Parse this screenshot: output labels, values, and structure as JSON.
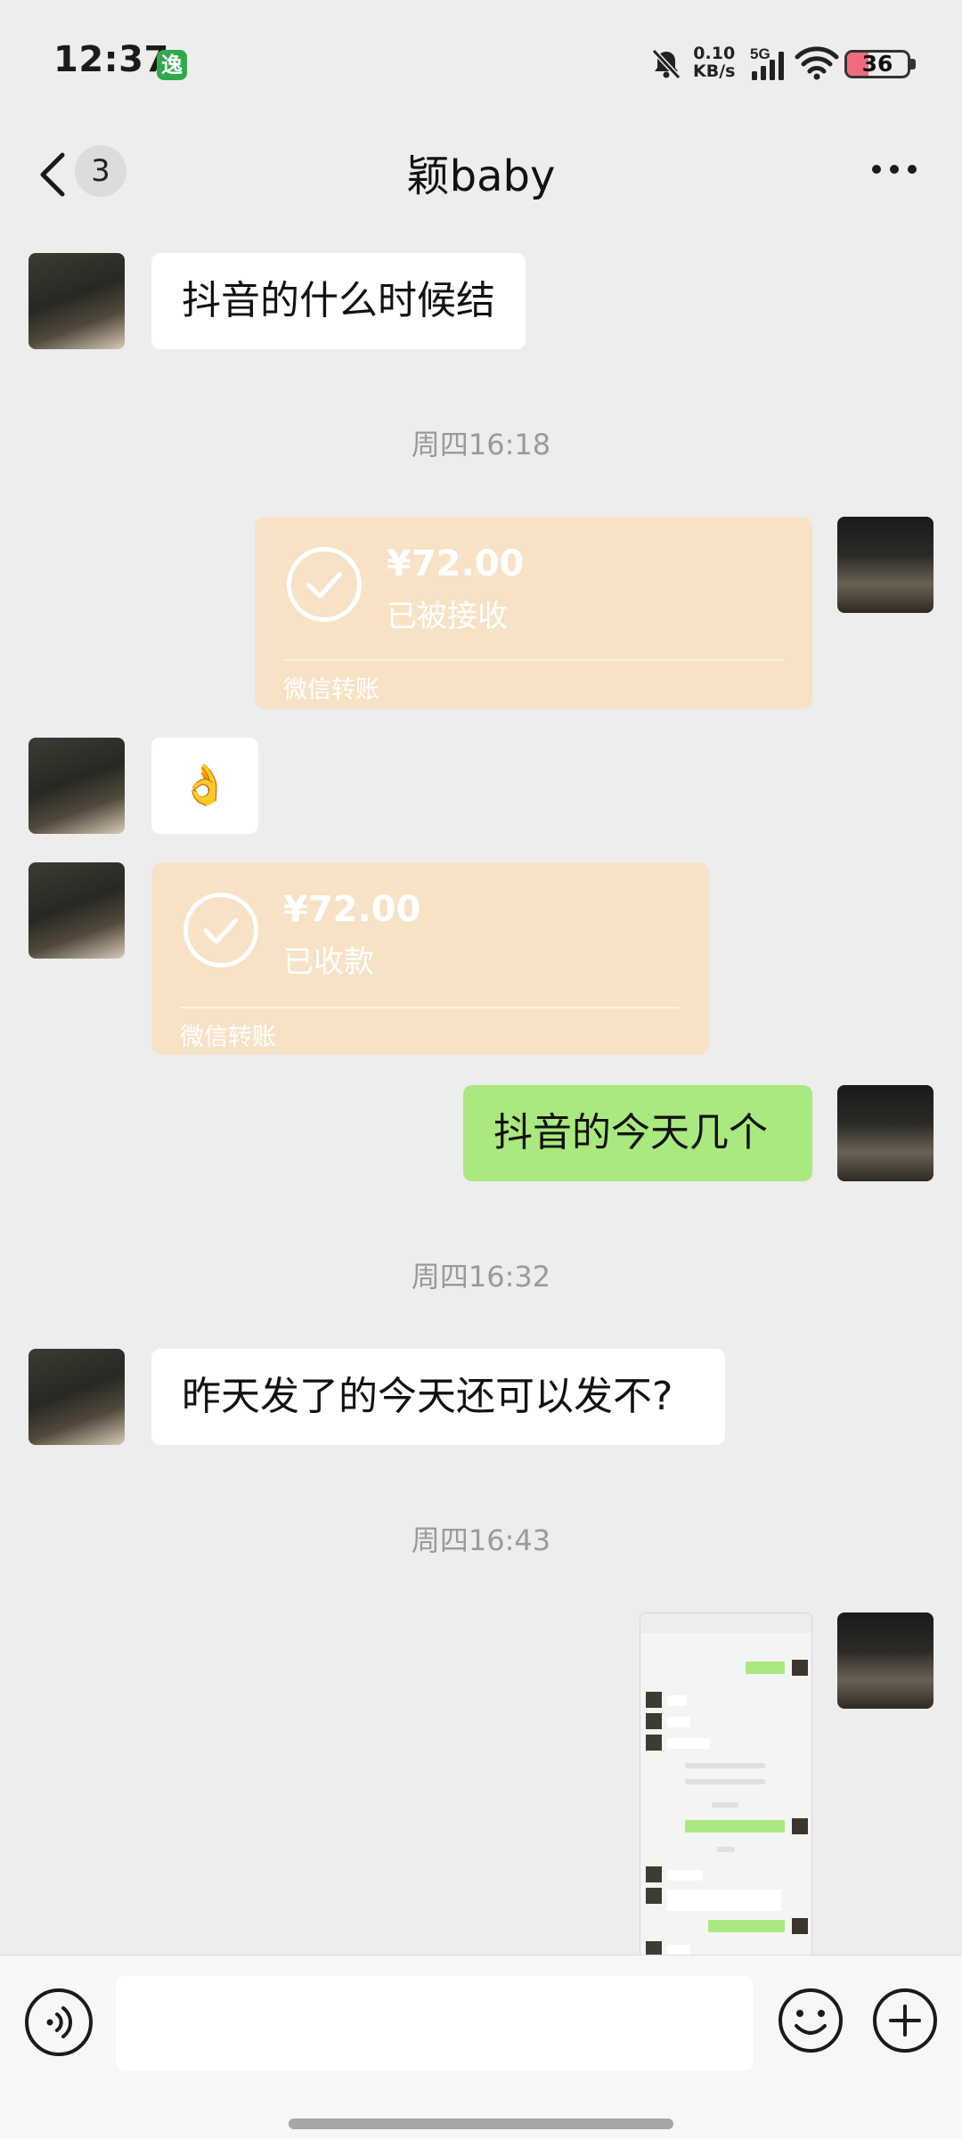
{
  "status_bar": {
    "time": "12:37",
    "app_badge": "",
    "net_speed_value": "0.10",
    "net_speed_unit": "KB/s",
    "network_type": "5G",
    "battery_level": "36",
    "battery_fraction": 0.36
  },
  "nav": {
    "unread_count": "3",
    "title": "颖baby"
  },
  "messages": {
    "m1_text": "抖音的什么时候结",
    "ts1": "周四16:18",
    "transfer_sent": {
      "amount": "¥72.00",
      "status": "已被接收",
      "footer": "微信转账"
    },
    "m3_emoji": "👌",
    "transfer_received": {
      "amount": "¥72.00",
      "status": "已收款",
      "footer": "微信转账"
    },
    "m5_text": "抖音的今天几个",
    "ts2": "周四16:32",
    "m6_text": "昨天发了的今天还可以发不?",
    "ts3": "周四16:43"
  },
  "input": {
    "placeholder": ""
  },
  "colors": {
    "background": "#ededed",
    "bubble_green": "#a9e97f",
    "bubble_white": "#ffffff",
    "transfer_card": "#f7e2c6"
  },
  "icons": [
    "back-chevron-icon",
    "more-icon",
    "mute-bell-icon",
    "signal-icon",
    "wifi-icon",
    "battery-icon",
    "voice-icon",
    "emoji-icon",
    "plus-icon",
    "check-icon"
  ]
}
